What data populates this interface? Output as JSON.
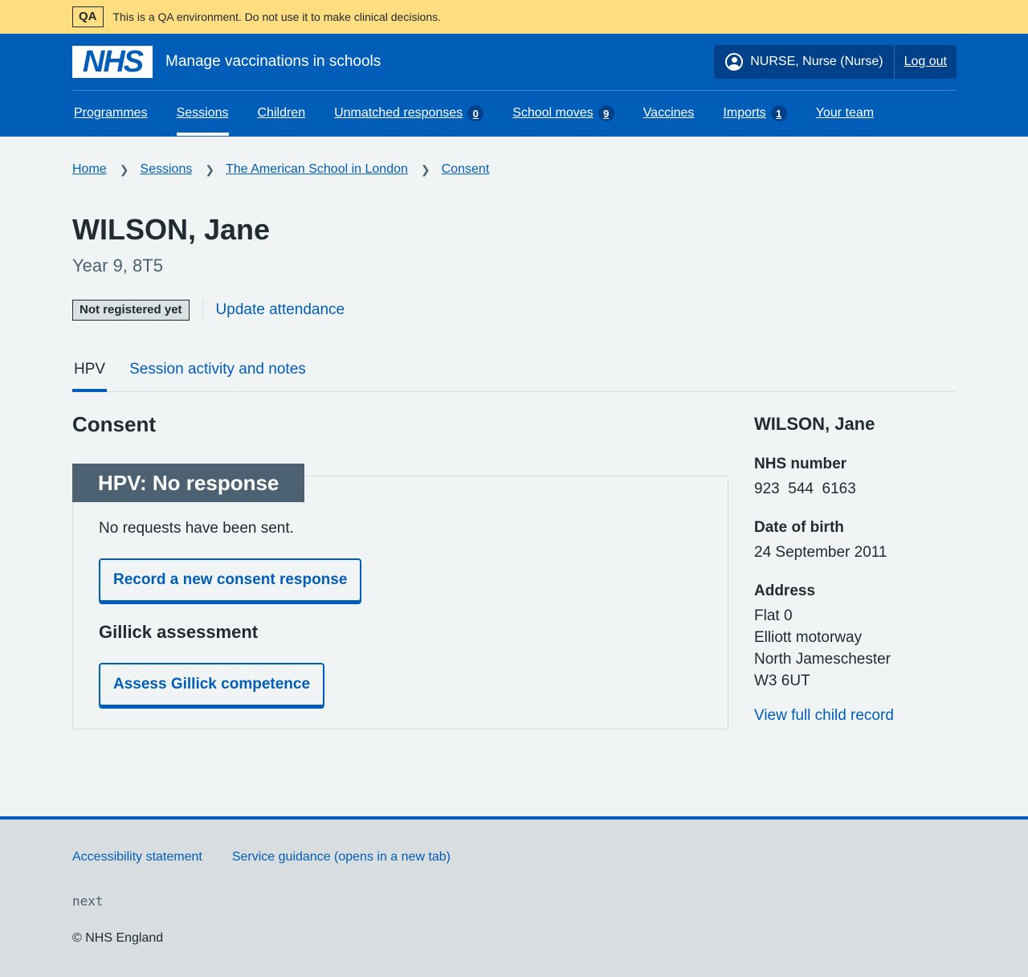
{
  "qa_banner": {
    "tag": "QA",
    "text": "This is a QA environment. Do not use it to make clinical decisions."
  },
  "header": {
    "logo": "NHS",
    "service_name": "Manage vaccinations in schools",
    "user": "NURSE, Nurse (Nurse)",
    "logout": "Log out"
  },
  "nav": {
    "items": [
      {
        "label": "Programmes"
      },
      {
        "label": "Sessions",
        "active": true
      },
      {
        "label": "Children"
      },
      {
        "label": "Unmatched responses",
        "count": "0"
      },
      {
        "label": "School moves",
        "count": "9"
      },
      {
        "label": "Vaccines"
      },
      {
        "label": "Imports",
        "count": "1"
      },
      {
        "label": "Your team"
      }
    ]
  },
  "breadcrumb": [
    "Home",
    "Sessions",
    "The American School in London",
    "Consent"
  ],
  "patient": {
    "name": "WILSON, Jane",
    "caption": "Year 9, 8T5",
    "status_tag": "Not registered yet",
    "update_attendance": "Update attendance"
  },
  "tabs": [
    "HPV",
    "Session activity and notes"
  ],
  "consent": {
    "title": "Consent",
    "card_heading": "HPV: No response",
    "message": "No requests have been sent.",
    "record_button": "Record a new consent response",
    "gillick_title": "Gillick assessment",
    "gillick_button": "Assess Gillick competence"
  },
  "summary": {
    "name": "WILSON, Jane",
    "nhs_label": "NHS number",
    "nhs_value": "923  544  6163",
    "dob_label": "Date of birth",
    "dob_value": "24 September 2011",
    "address_label": "Address",
    "address_lines": [
      "Flat 0",
      "Elliott motorway",
      "North Jameschester",
      "W3 6UT"
    ],
    "view_link": "View full child record"
  },
  "footer": {
    "links": [
      "Accessibility statement",
      "Service guidance (opens in a new tab)"
    ],
    "version": "next",
    "copyright": "© NHS England"
  },
  "colors": {
    "nhs_blue": "#005eb8",
    "qa_yellow": "#ffdd81",
    "card_heading": "#4c6272"
  }
}
